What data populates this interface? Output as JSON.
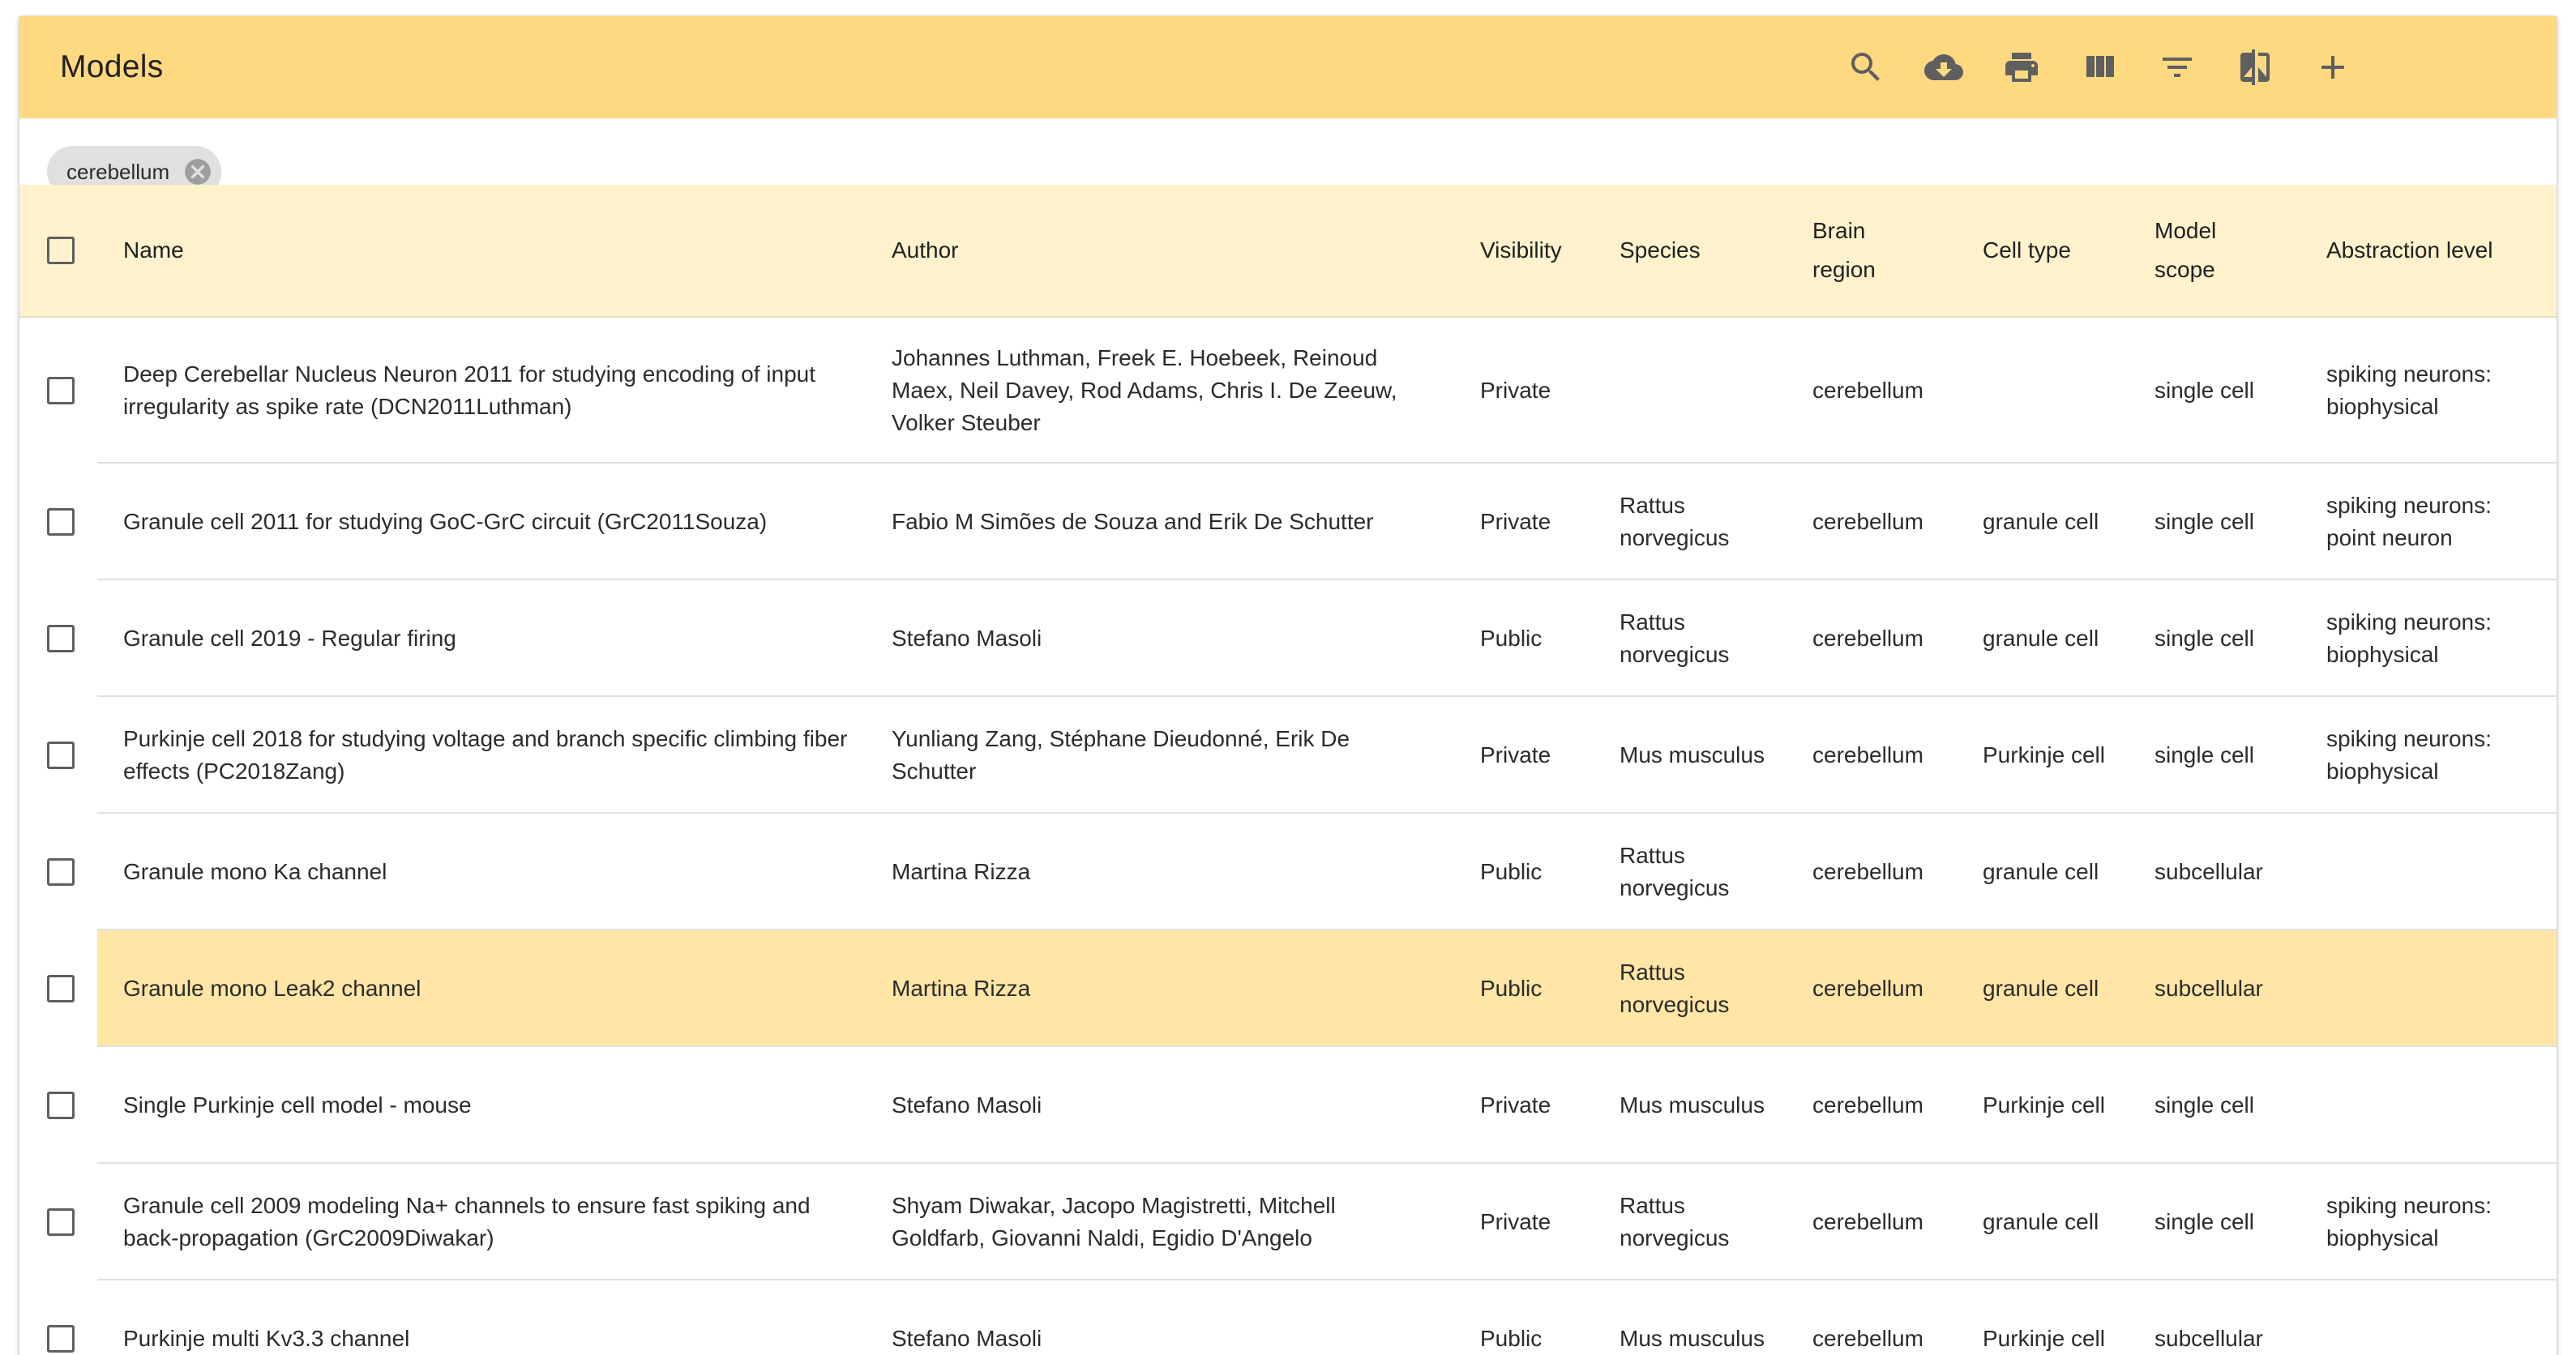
{
  "toolbar": {
    "title": "Models",
    "icons": [
      "search-icon",
      "cloud-download-icon",
      "print-icon",
      "view-column-icon",
      "filter-icon",
      "compare-icon",
      "add-icon"
    ]
  },
  "filter_chips": [
    {
      "label": "cerebellum"
    }
  ],
  "table": {
    "columns": [
      "Name",
      "Author",
      "Visibility",
      "Species",
      "Brain region",
      "Cell type",
      "Model scope",
      "Abstraction level"
    ],
    "rows": [
      {
        "name": "Deep Cerebellar Nucleus Neuron 2011 for studying encoding of input irregularity as spike rate (DCN2011Luthman)",
        "author": "Johannes Luthman, Freek E. Hoebeek, Reinoud Maex, Neil Davey, Rod Adams, Chris I. De Zeeuw, Volker Steuber",
        "visibility": "Private",
        "species": "",
        "brain_region": "cerebellum",
        "cell_type": "",
        "model_scope": "single cell",
        "abstraction_level": "spiking neurons: biophysical"
      },
      {
        "name": "Granule cell 2011 for studying GoC-GrC circuit (GrC2011Souza)",
        "author": "Fabio M Simões de Souza and Erik De Schutter",
        "visibility": "Private",
        "species": "Rattus norvegicus",
        "brain_region": "cerebellum",
        "cell_type": "granule cell",
        "model_scope": "single cell",
        "abstraction_level": "spiking neurons: point neuron"
      },
      {
        "name": "Granule cell 2019 - Regular firing",
        "author": "Stefano Masoli",
        "visibility": "Public",
        "species": "Rattus norvegicus",
        "brain_region": "cerebellum",
        "cell_type": "granule cell",
        "model_scope": "single cell",
        "abstraction_level": "spiking neurons: biophysical"
      },
      {
        "name": "Purkinje cell 2018 for studying voltage and branch specific climbing fiber effects (PC2018Zang)",
        "author": "Yunliang Zang, Stéphane Dieudonné, Erik De Schutter",
        "visibility": "Private",
        "species": "Mus musculus",
        "brain_region": "cerebellum",
        "cell_type": "Purkinje cell",
        "model_scope": "single cell",
        "abstraction_level": "spiking neurons: biophysical"
      },
      {
        "name": "Granule mono Ka channel",
        "author": "Martina Rizza",
        "visibility": "Public",
        "species": "Rattus norvegicus",
        "brain_region": "cerebellum",
        "cell_type": "granule cell",
        "model_scope": "subcellular",
        "abstraction_level": ""
      },
      {
        "name": "Granule mono Leak2 channel",
        "author": "Martina Rizza",
        "visibility": "Public",
        "species": "Rattus norvegicus",
        "brain_region": "cerebellum",
        "cell_type": "granule cell",
        "model_scope": "subcellular",
        "abstraction_level": "",
        "highlighted": true
      },
      {
        "name": "Single Purkinje cell model - mouse",
        "author": "Stefano Masoli",
        "visibility": "Private",
        "species": "Mus musculus",
        "brain_region": "cerebellum",
        "cell_type": "Purkinje cell",
        "model_scope": "single cell",
        "abstraction_level": ""
      },
      {
        "name": "Granule cell 2009 modeling Na+ channels to ensure fast spiking and back-propagation (GrC2009Diwakar)",
        "author": "Shyam Diwakar, Jacopo Magistretti, Mitchell Goldfarb, Giovanni Naldi, Egidio D'Angelo",
        "visibility": "Private",
        "species": "Rattus norvegicus",
        "brain_region": "cerebellum",
        "cell_type": "granule cell",
        "model_scope": "single cell",
        "abstraction_level": "spiking neurons: biophysical"
      },
      {
        "name": "Purkinje multi Kv3.3 channel",
        "author": "Stefano Masoli",
        "visibility": "Public",
        "species": "Mus musculus",
        "brain_region": "cerebellum",
        "cell_type": "Purkinje cell",
        "model_scope": "subcellular",
        "abstraction_level": ""
      }
    ]
  },
  "colors": {
    "toolbar_bg": "#ffd980",
    "header_bg": "#fff2cc",
    "highlight_row_bg": "#ffe6a6",
    "chip_bg": "#e0e0e0"
  }
}
